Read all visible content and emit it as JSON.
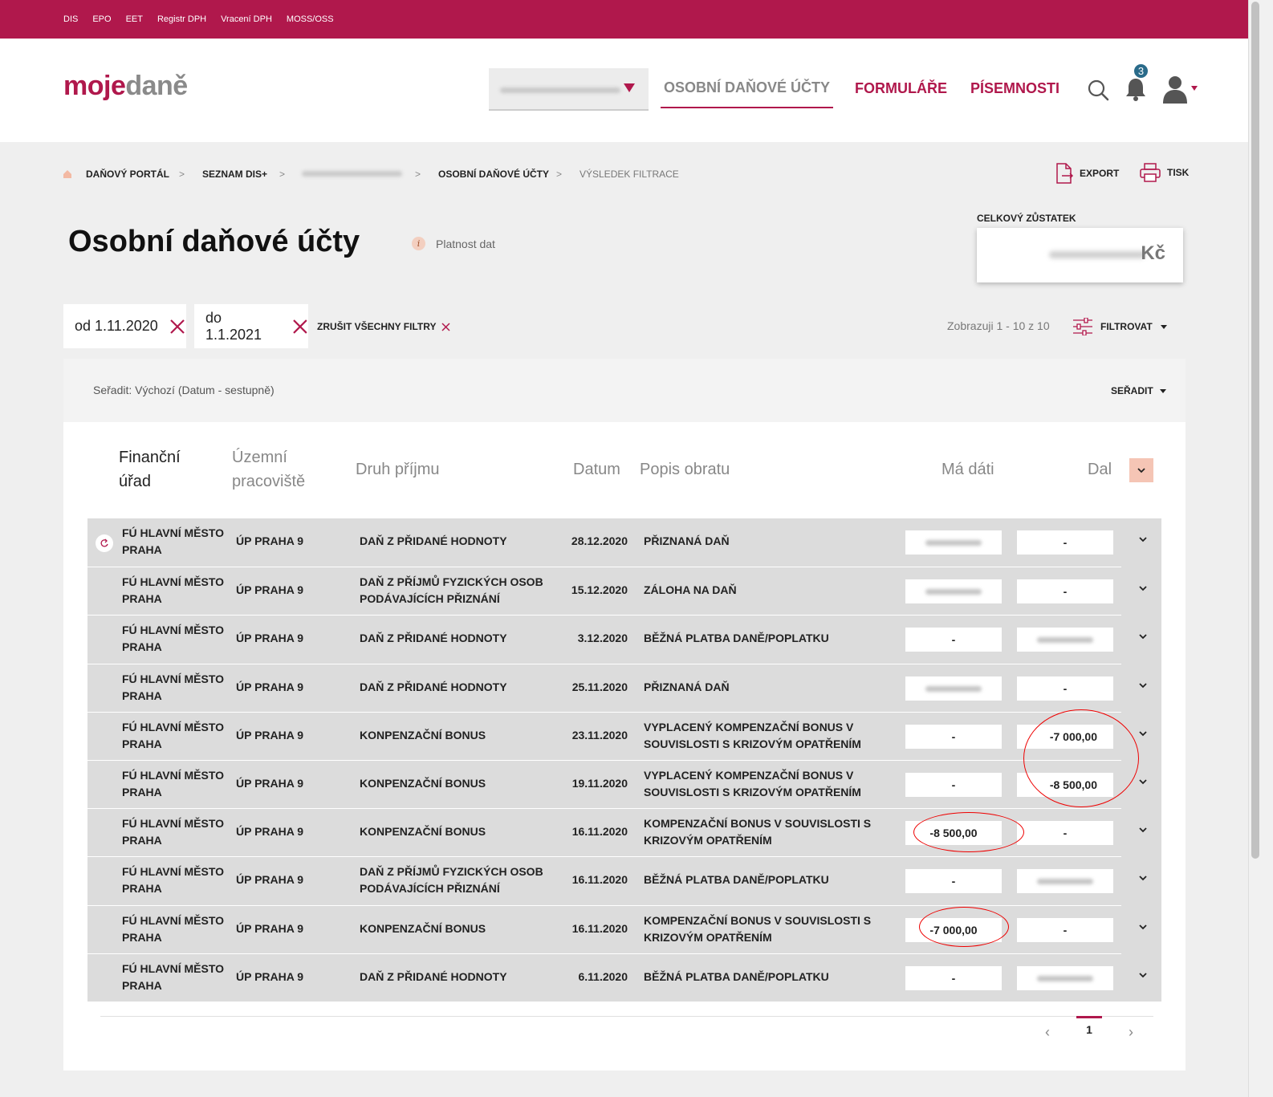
{
  "topbar": {
    "links": [
      "DIS",
      "EPO",
      "EET",
      "Registr DPH",
      "Vracení DPH",
      "MOSS/OSS"
    ]
  },
  "header": {
    "logo": {
      "part1": "moje",
      "part2": "daně"
    },
    "nav": {
      "active": "OSOBNÍ DAŇOVÉ ÚČTY",
      "forms": "FORMULÁŘE",
      "documents": "PÍSEMNOSTI"
    },
    "notifications_count": "3",
    "icons": [
      "search-icon",
      "bell-icon",
      "user-icon"
    ]
  },
  "breadcrumb": {
    "items": [
      "DAŇOVÝ PORTÁL",
      "SEZNAM DIS+",
      "OSOBNÍ DAŇOVÉ ÚČTY",
      "VÝSLEDEK FILTRACE"
    ],
    "separator": ">"
  },
  "actions": {
    "export": "EXPORT",
    "print": "TISK"
  },
  "page": {
    "title": "Osobní daňové účty",
    "validity": "Platnost dat",
    "balance_label": "CELKOVÝ ZŮSTATEK",
    "balance_currency": "Kč"
  },
  "filters": {
    "chips": [
      "od 1.11.2020",
      "do 1.1.2021"
    ],
    "clear_all": "ZRUŠIT VŠECHNY FILTRY",
    "showing": "Zobrazuji 1 - 10 z 10",
    "filter_button": "FILTROVAT"
  },
  "sorting": {
    "current": "Seřadit: Výchozí (Datum - sestupně)",
    "button": "SEŘADIT"
  },
  "table": {
    "headers": {
      "office": [
        "Finanční",
        "úřad"
      ],
      "workplace": [
        "Územní",
        "pracoviště"
      ],
      "income_type": "Druh příjmu",
      "date": "Datum",
      "description": "Popis obratu",
      "debit": "Má dáti",
      "credit": "Dal"
    },
    "rows": [
      {
        "office": [
          "FÚ HLAVNÍ MĚSTO",
          "PRAHA"
        ],
        "workplace": "ÚP PRAHA 9",
        "income_type": [
          "DAŇ Z PŘIDANÉ HODNOTY"
        ],
        "date": "28.12.2020",
        "description": [
          "PŘIZNANÁ DAŇ"
        ],
        "debit": "",
        "credit": "-"
      },
      {
        "office": [
          "FÚ HLAVNÍ MĚSTO",
          "PRAHA"
        ],
        "workplace": "ÚP PRAHA 9",
        "income_type": [
          "DAŇ Z PŘÍJMŮ FYZICKÝCH OSOB",
          "PODÁVAJÍCÍCH PŘIZNÁNÍ"
        ],
        "date": "15.12.2020",
        "description": [
          "ZÁLOHA NA DAŇ"
        ],
        "debit": "",
        "credit": "-"
      },
      {
        "office": [
          "FÚ HLAVNÍ MĚSTO",
          "PRAHA"
        ],
        "workplace": "ÚP PRAHA 9",
        "income_type": [
          "DAŇ Z PŘIDANÉ HODNOTY"
        ],
        "date": "3.12.2020",
        "description": [
          "BĚŽNÁ PLATBA DANĚ/POPLATKU"
        ],
        "debit": "-",
        "credit": ""
      },
      {
        "office": [
          "FÚ HLAVNÍ MĚSTO",
          "PRAHA"
        ],
        "workplace": "ÚP PRAHA 9",
        "income_type": [
          "DAŇ Z PŘIDANÉ HODNOTY"
        ],
        "date": "25.11.2020",
        "description": [
          "PŘIZNANÁ DAŇ"
        ],
        "debit": "",
        "credit": "-"
      },
      {
        "office": [
          "FÚ HLAVNÍ MĚSTO",
          "PRAHA"
        ],
        "workplace": "ÚP PRAHA 9",
        "income_type": [
          "KONPENZAČNÍ BONUS"
        ],
        "date": "23.11.2020",
        "description": [
          "VYPLACENÝ KOMPENZAČNÍ BONUS V",
          "SOUVISLOSTI S KRIZOVÝM OPATŘENÍM"
        ],
        "debit": "-",
        "credit": "-7 000,00"
      },
      {
        "office": [
          "FÚ HLAVNÍ MĚSTO",
          "PRAHA"
        ],
        "workplace": "ÚP PRAHA 9",
        "income_type": [
          "KONPENZAČNÍ BONUS"
        ],
        "date": "19.11.2020",
        "description": [
          "VYPLACENÝ KOMPENZAČNÍ BONUS V",
          "SOUVISLOSTI S KRIZOVÝM OPATŘENÍM"
        ],
        "debit": "-",
        "credit": "-8 500,00"
      },
      {
        "office": [
          "FÚ HLAVNÍ MĚSTO",
          "PRAHA"
        ],
        "workplace": "ÚP PRAHA 9",
        "income_type": [
          "KONPENZAČNÍ BONUS"
        ],
        "date": "16.11.2020",
        "description": [
          "KOMPENZAČNÍ BONUS V SOUVISLOSTI S",
          "KRIZOVÝM OPATŘENÍM"
        ],
        "debit": "-8 500,00",
        "credit": "-"
      },
      {
        "office": [
          "FÚ HLAVNÍ MĚSTO",
          "PRAHA"
        ],
        "workplace": "ÚP PRAHA 9",
        "income_type": [
          "DAŇ Z PŘÍJMŮ FYZICKÝCH OSOB",
          "PODÁVAJÍCÍCH PŘIZNÁNÍ"
        ],
        "date": "16.11.2020",
        "description": [
          "BĚŽNÁ PLATBA DANĚ/POPLATKU"
        ],
        "debit": "-",
        "credit": ""
      },
      {
        "office": [
          "FÚ HLAVNÍ MĚSTO",
          "PRAHA"
        ],
        "workplace": "ÚP PRAHA 9",
        "income_type": [
          "KONPENZAČNÍ BONUS"
        ],
        "date": "16.11.2020",
        "description": [
          "KOMPENZAČNÍ BONUS V SOUVISLOSTI S",
          "KRIZOVÝM OPATŘENÍM"
        ],
        "debit": "-7 000,00",
        "credit": "-"
      },
      {
        "office": [
          "FÚ HLAVNÍ MĚSTO",
          "PRAHA"
        ],
        "workplace": "ÚP PRAHA 9",
        "income_type": [
          "DAŇ Z PŘIDANÉ HODNOTY"
        ],
        "date": "6.11.2020",
        "description": [
          "BĚŽNÁ PLATBA DANĚ/POPLATKU"
        ],
        "debit": "-",
        "credit": ""
      }
    ]
  },
  "pagination": {
    "prev": "‹",
    "page": "1",
    "next": "›"
  },
  "colors": {
    "brand": "#b0184c",
    "annotation": "#e00000",
    "badge": "#2a6b8a"
  }
}
